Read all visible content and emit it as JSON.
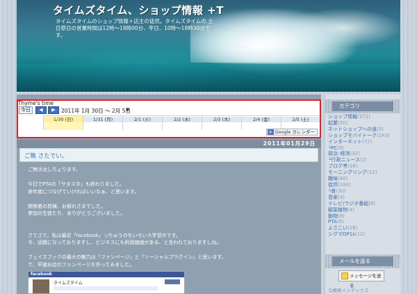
{
  "header": {
    "title": "タイムズタイム、ショップ情報 +T",
    "description": "タイムズタイムのショップ情報＋店主の徒然。タイムズタイムの 土日祭日の営業時間は12時～18時00分、平日、10時～18時30分です。"
  },
  "calendar": {
    "title": "Thyme's time",
    "today_label": "今日",
    "prev_label": "◀",
    "next_label": "▶",
    "range": "2011年 1月 30日 ～ 2月 5日",
    "dropdown": "▼",
    "days": [
      "1/30 (日)",
      "1/31 (月)",
      "2/1 (火)",
      "2/2 (水)",
      "2/3 (木)",
      "2/4 (金)",
      "2/5 (土)"
    ],
    "badge": "Google カレンダー",
    "badge_plus": "+"
  },
  "post": {
    "date": "2011年01月29日",
    "title": "ご無 さたでい。",
    "paragraphs": [
      "ご無沙汰しちょります。",
      "",
      "今日でPTAの「サタスタ」も終わりました。",
      "来年度につなげていければいいなぁ、と思います。",
      "",
      "関係者の皆様、お疲れさまでした。",
      "参加の生徒たち、ありがとうございました。",
      "",
      "",
      "さてさて、私は最近「facebook」っちゅうのをいろいろ学習中です。",
      "今、話題になっておりますし、ビジネスにも利用価値がある、と言われておりますしね。",
      "",
      "フェイスブックの最大の魅力は「ファンページ」と「ソーシャルプラグイン」と思います。",
      "で、早速お店のファンページを作ってみました。"
    ],
    "embed": {
      "brand": "facebook",
      "page_name": "タイムズタイム"
    }
  },
  "sidebar": {
    "categories_heading": "カテゴリ",
    "categories": [
      {
        "name": "ショップ情報",
        "count": "(372)"
      },
      {
        "name": "起業",
        "count": "(50)"
      },
      {
        "name": "ネットショップへの道",
        "count": "(5)"
      },
      {
        "name": "ショップモバイトーク",
        "count": "(243)"
      },
      {
        "name": "インターネット",
        "count": "(72)"
      },
      {
        "name": "└PC",
        "count": "(9)"
      },
      {
        "name": "政治･経済",
        "count": "(32)"
      },
      {
        "name": "└行政ニュース",
        "count": "(2)"
      },
      {
        "name": "ブログ考",
        "count": "(18)"
      },
      {
        "name": "モーニングリング",
        "count": "(12)"
      },
      {
        "name": "趣味",
        "count": "(60)"
      },
      {
        "name": "徒然",
        "count": "(184)"
      },
      {
        "name": "└食",
        "count": "(30)"
      },
      {
        "name": "音楽",
        "count": "(3)"
      },
      {
        "name": "テレビ/ラジオ番組",
        "count": "(6)"
      },
      {
        "name": "観葉植物",
        "count": "(4)"
      },
      {
        "name": "動物",
        "count": "(8)"
      },
      {
        "name": "PTA",
        "count": "(6)"
      },
      {
        "name": "よさこい",
        "count": "(18)"
      },
      {
        "name": "シグマDP1s",
        "count": "(12)"
      }
    ],
    "mail_heading": "メールを送る",
    "message_button": "メッセージを送る",
    "below_label": "Ｑ検索インデックス"
  },
  "colors": {
    "calendar_highlight_border": "#e2202c",
    "link": "#3b6fb0",
    "today_cell": "#fff7b8"
  }
}
